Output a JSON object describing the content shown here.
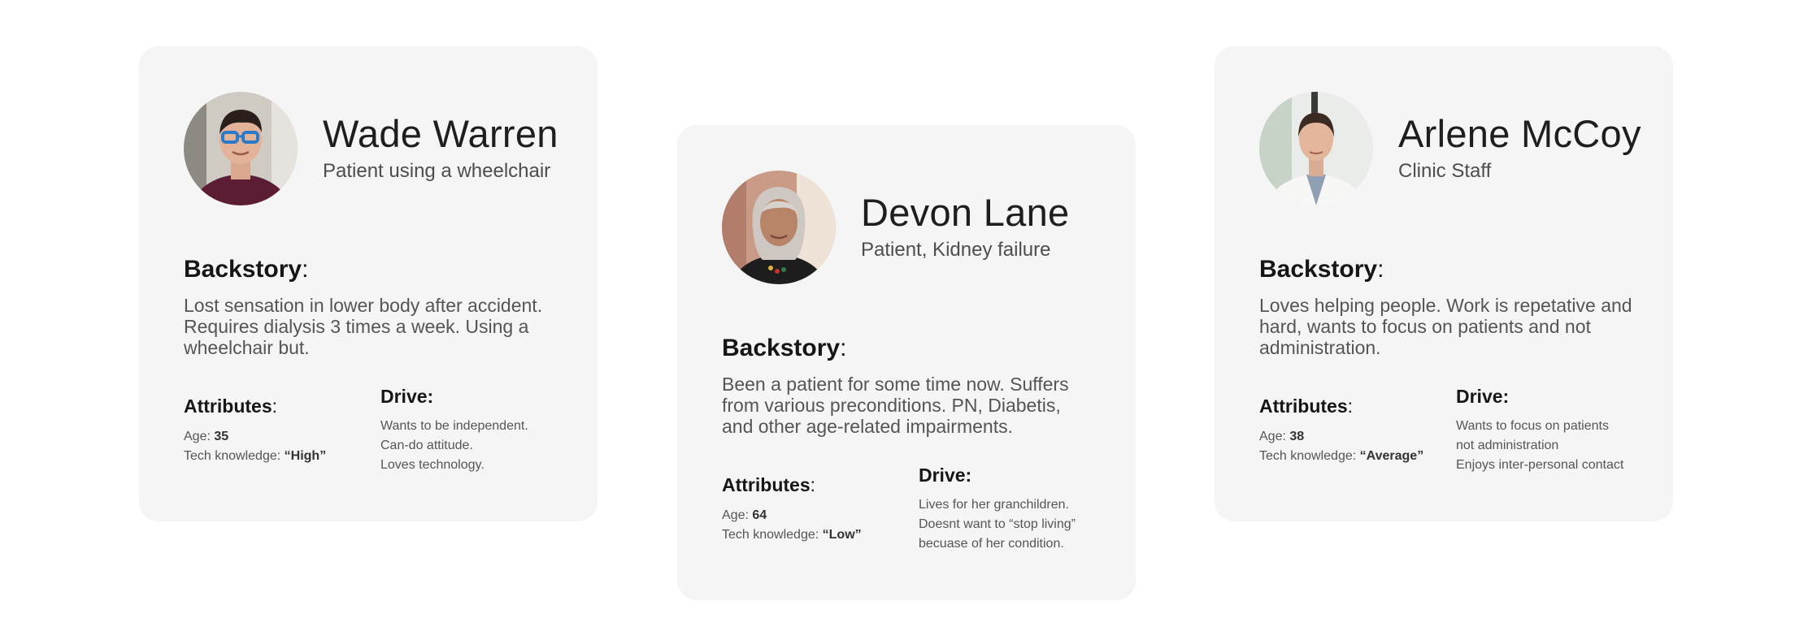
{
  "personas": [
    {
      "name": "Wade Warren",
      "role": "Patient using a wheelchair",
      "backstory_label": "Backstory",
      "backstory_suffix": ":",
      "backstory": "Lost sensation in lower body after accident. Requires dialysis 3 times a week. Using a wheelchair but.",
      "attributes_label": "Attributes",
      "attributes_suffix": ":",
      "age_label": "Age: ",
      "age": "35",
      "tech_label": "Tech knowledge: ",
      "tech": "“High”",
      "drive_label": "Drive:",
      "drive": [
        "Wants to be independent.",
        "Can-do attitude.",
        "Loves technology."
      ]
    },
    {
      "name": "Devon Lane",
      "role": "Patient, Kidney failure",
      "backstory_label": "Backstory",
      "backstory_suffix": ":",
      "backstory": "Been a patient for some time now. Suffers from various preconditions. PN, Diabetis, and other age-related impairments.",
      "attributes_label": "Attributes",
      "attributes_suffix": ":",
      "age_label": "Age: ",
      "age": "64",
      "tech_label": "Tech knowledge: ",
      "tech": "“Low”",
      "drive_label": "Drive:",
      "drive": [
        "Lives for her granchildren.",
        "Doesnt want to “stop living”",
        "becuase of her condition."
      ]
    },
    {
      "name": "Arlene McCoy",
      "role": "Clinic Staff",
      "backstory_label": "Backstory",
      "backstory_suffix": ":",
      "backstory": "Loves helping people. Work is repetative and hard, wants to focus on patients and not administration.",
      "attributes_label": "Attributes",
      "attributes_suffix": ":",
      "age_label": "Age: ",
      "age": "38",
      "tech_label": "Tech knowledge: ",
      "tech": "“Average”",
      "drive_label": "Drive:",
      "drive": [
        "Wants to focus on patients",
        "not administration",
        "Enjoys inter-personal contact"
      ]
    }
  ]
}
